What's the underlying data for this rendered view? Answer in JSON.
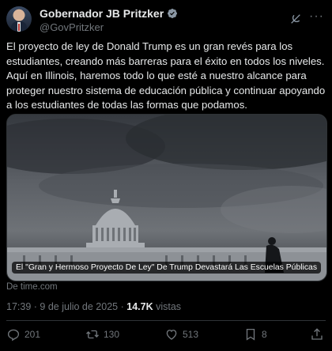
{
  "author": {
    "display_name": "Gobernador JB Pritzker",
    "handle": "@GovPritzker",
    "verified": true
  },
  "icons": {
    "verified": "verified-badge-icon",
    "grok": "grok-icon",
    "more": "more-icon",
    "reply": "reply-icon",
    "repost": "repost-icon",
    "like": "like-icon",
    "bookmark": "bookmark-icon",
    "share": "share-icon"
  },
  "tweet": {
    "text": "El proyecto de ley de Donald Trump es un gran revés para los estudiantes, creando más barreras para el éxito en todos los niveles.\nAquí en Illinois, haremos todo lo que esté a nuestro alcance para proteger nuestro sistema de educación pública y continuar apoyando a los estudiantes de todas las formas que podamos."
  },
  "media": {
    "caption": "El \"Gran y Hermoso Proyecto De Ley\" De Trump Devastará Las Escuelas Públicas",
    "source": "De time.com"
  },
  "meta": {
    "time": "17:39",
    "separator": "·",
    "date": "9 de julio de 2025",
    "views_count": "14.7K",
    "views_label": "vistas"
  },
  "actions": {
    "replies": "201",
    "reposts": "130",
    "likes": "513",
    "bookmarks": "8"
  },
  "colors": {
    "background": "#000000",
    "text": "#e7e9ea",
    "muted": "#71767b",
    "verified": "#1d9bf0",
    "divider": "#2f3336"
  }
}
